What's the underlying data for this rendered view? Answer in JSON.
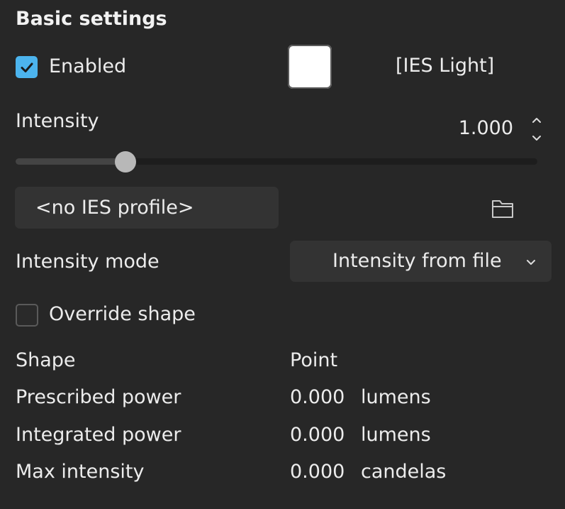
{
  "section": {
    "title": "Basic settings"
  },
  "enabled": {
    "label": "Enabled",
    "checked": true
  },
  "light": {
    "color": "#ffffff",
    "type_label": "[IES Light]"
  },
  "intensity": {
    "label": "Intensity",
    "value": "1.000",
    "slider_fraction": 0.21
  },
  "ies_profile": {
    "value": "<no IES profile>"
  },
  "intensity_mode": {
    "label": "Intensity mode",
    "selected": "Intensity from file"
  },
  "override_shape": {
    "label": "Override shape",
    "checked": false
  },
  "info": {
    "shape": {
      "label": "Shape",
      "value": "Point"
    },
    "prescribed_power": {
      "label": "Prescribed power",
      "value": "0.000",
      "unit": "lumens"
    },
    "integrated_power": {
      "label": "Integrated power",
      "value": "0.000",
      "unit": "lumens"
    },
    "max_intensity": {
      "label": "Max intensity",
      "value": "0.000",
      "unit": "candelas"
    }
  },
  "icons": {
    "checkbox": "checkmark-icon",
    "stepper_up": "chevron-up-icon",
    "stepper_down": "chevron-down-icon",
    "browse": "folder-icon",
    "select": "chevron-down-icon"
  },
  "colors": {
    "accent": "#4cb4ee",
    "panel": "#272727",
    "field": "#333333"
  }
}
